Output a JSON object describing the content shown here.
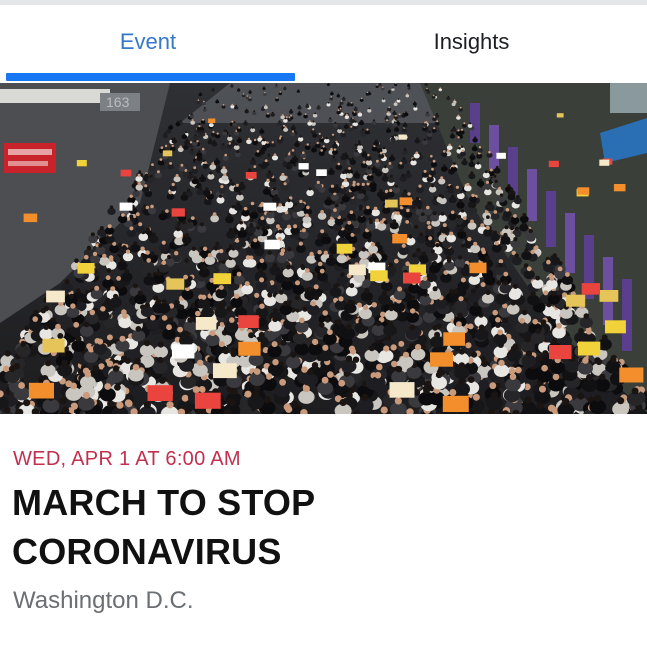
{
  "tabs": [
    {
      "label": "Event",
      "active": true
    },
    {
      "label": "Insights",
      "active": false
    }
  ],
  "photo": {
    "subject": "crowd-photo",
    "sign_text": "163"
  },
  "event": {
    "date": "WED, APR 1 AT 6:00 AM",
    "title_line1": "MARCH TO STOP",
    "title_line2": "CORONAVIRUS",
    "location": "Washington D.C."
  },
  "colors": {
    "tab_active": "#3578c7",
    "tab_indicator": "#1877f2",
    "date": "#c1304f",
    "title": "#111111",
    "location": "#6b6e73"
  }
}
